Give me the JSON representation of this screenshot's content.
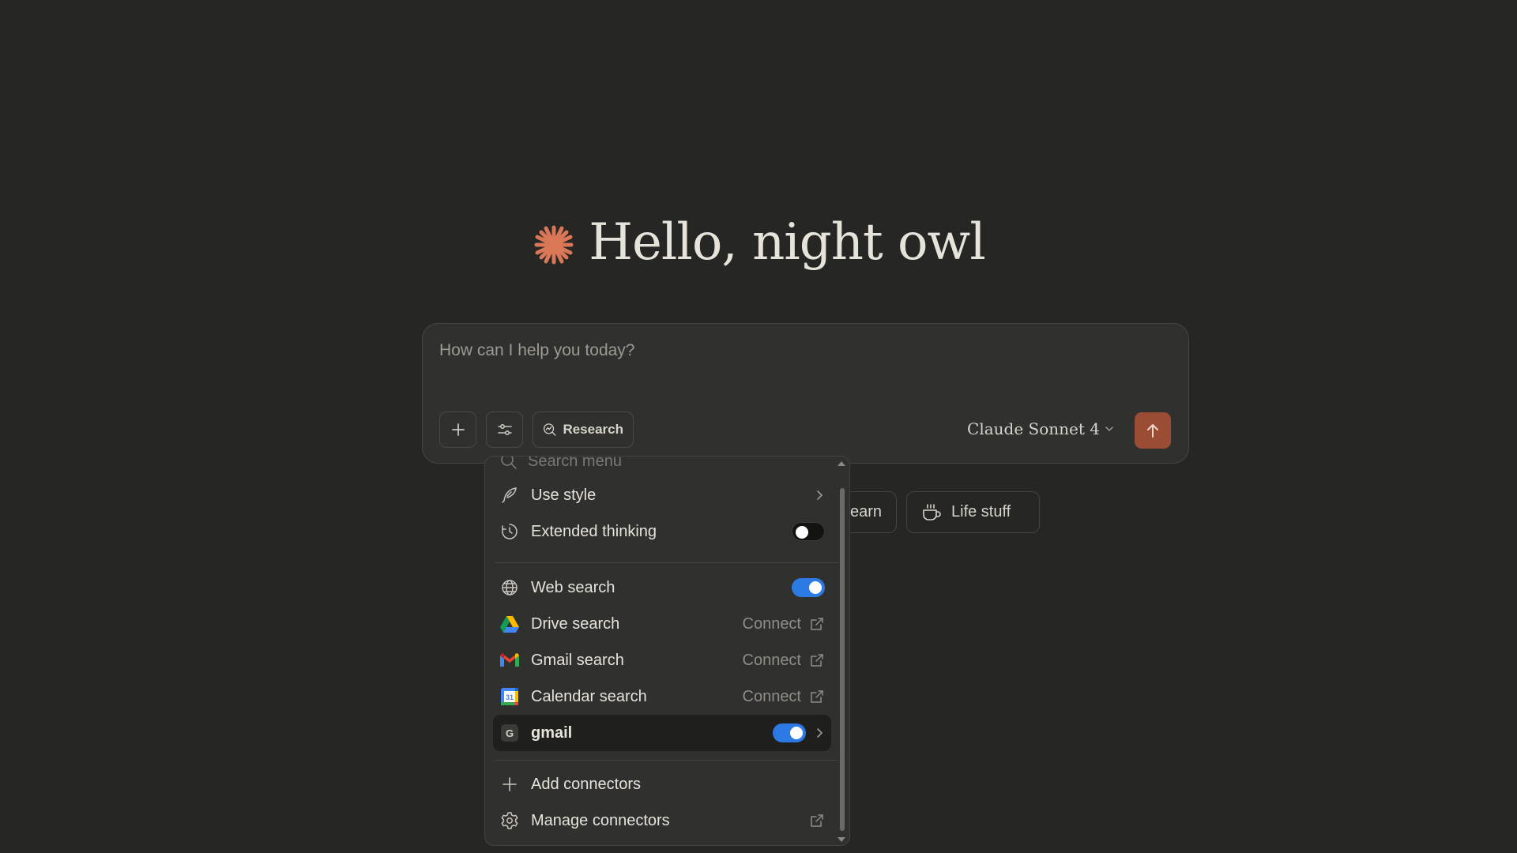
{
  "greeting": {
    "text": "Hello, night owl"
  },
  "composer": {
    "placeholder": "How can I help you today?",
    "research_label": "Research",
    "model_label": "Claude Sonnet 4"
  },
  "chips": {
    "learn_label": "earn",
    "life_label": "Life stuff"
  },
  "menu": {
    "search_placeholder": "Search menu",
    "items": {
      "use_style": "Use style",
      "extended_thinking": "Extended thinking",
      "web_search": "Web search",
      "drive_search": "Drive search",
      "gmail_search": "Gmail search",
      "calendar_search": "Calendar search",
      "gmail_connector": "gmail",
      "gmail_badge": "G",
      "add_connectors": "Add connectors",
      "manage_connectors": "Manage connectors"
    },
    "connect_label": "Connect",
    "calendar_day": "31",
    "toggles": {
      "extended_thinking": false,
      "web_search": true,
      "gmail_connector": true
    }
  },
  "colors": {
    "background": "#262624",
    "accent": "#d97757",
    "send_button": "#9a4c34",
    "toggle_on": "#2c7be5"
  }
}
